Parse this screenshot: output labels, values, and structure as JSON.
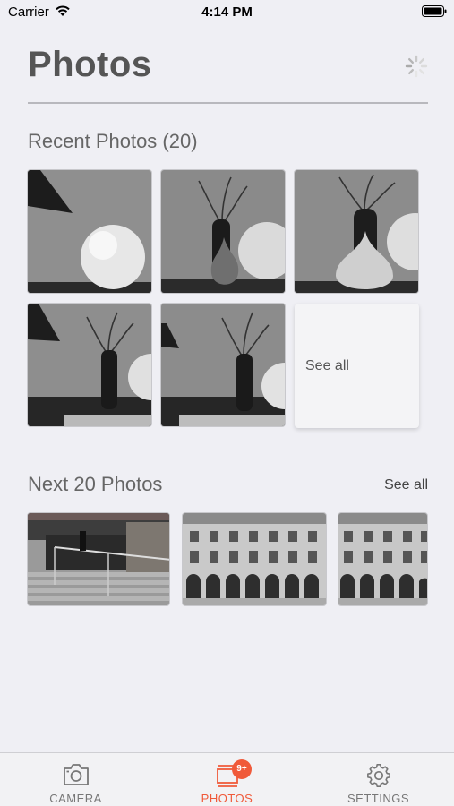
{
  "status_bar": {
    "carrier": "Carrier",
    "time": "4:14 PM"
  },
  "header": {
    "title": "Photos"
  },
  "recent": {
    "heading": "Recent Photos (20)",
    "see_all_label": "See all"
  },
  "next": {
    "heading": "Next 20 Photos",
    "see_all_label": "See all"
  },
  "tab_bar": {
    "tabs": [
      {
        "label": "CAMERA",
        "icon": "camera-icon",
        "selected": false
      },
      {
        "label": "PHOTOS",
        "icon": "photos-icon",
        "selected": true,
        "badge": "9+"
      },
      {
        "label": "SETTINGS",
        "icon": "gear-icon",
        "selected": false
      }
    ]
  },
  "colors": {
    "accent": "#f05a3a",
    "background": "#efeff4",
    "text": "#555555"
  }
}
